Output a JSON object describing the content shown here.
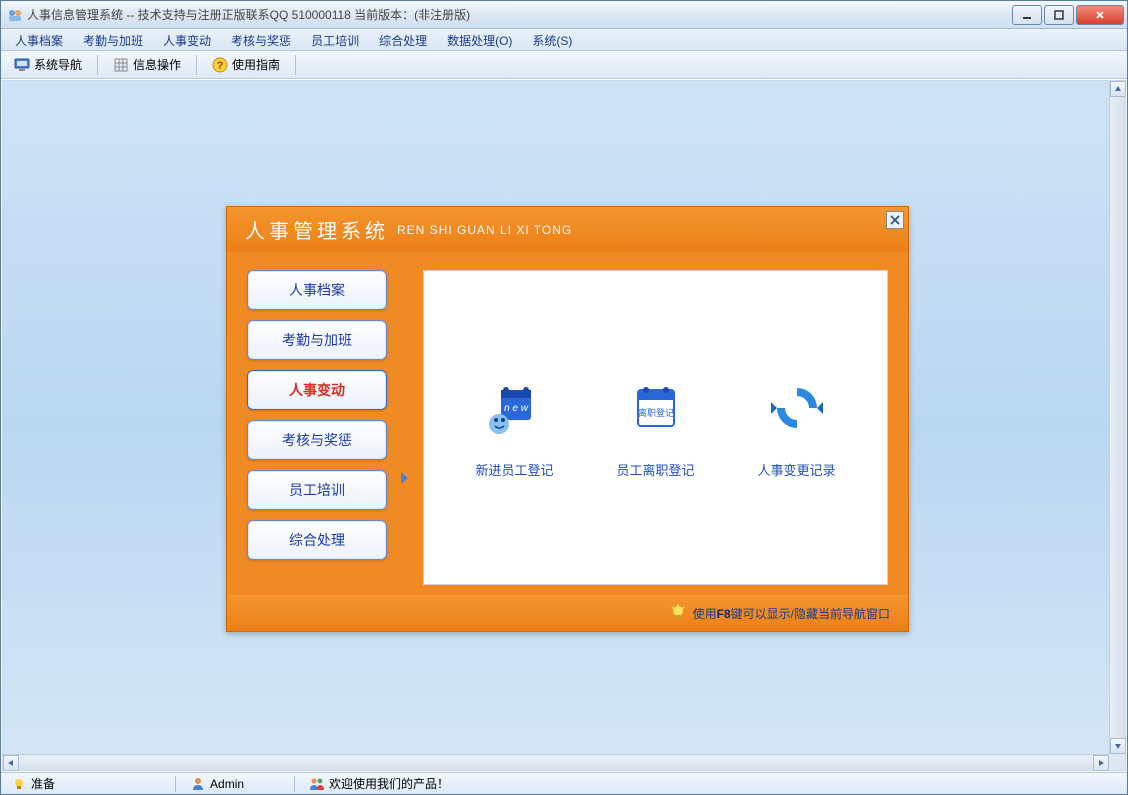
{
  "window": {
    "title": "人事信息管理系统 -- 技术支持与注册正版联系QQ 510000118   当前版本：(非注册版)"
  },
  "menubar": {
    "items": [
      "人事档案",
      "考勤与加班",
      "人事变动",
      "考核与奖惩",
      "员工培训",
      "综合处理",
      "数据处理(O)",
      "系统(S)"
    ]
  },
  "toolbar": {
    "nav_label": "系统导航",
    "info_label": "信息操作",
    "guide_label": "使用指南"
  },
  "nav_panel": {
    "title_cn": "人事管理系统",
    "title_en": "REN SHI GUAN LI XI TONG",
    "side_items": [
      "人事档案",
      "考勤与加班",
      "人事变动",
      "考核与奖惩",
      "员工培训",
      "综合处理"
    ],
    "active_index": 2,
    "functions": [
      {
        "label": "新进员工登记",
        "icon": "new"
      },
      {
        "label": "员工离职登记",
        "icon": "leave",
        "icon_text": "离职登记"
      },
      {
        "label": "人事变更记录",
        "icon": "sync"
      }
    ],
    "hint_prefix": "使用",
    "hint_key": "F8",
    "hint_suffix": "键可以显示/隐藏当前导航窗口"
  },
  "statusbar": {
    "ready": "准备",
    "user": "Admin",
    "welcome": "欢迎使用我们的产品！"
  }
}
